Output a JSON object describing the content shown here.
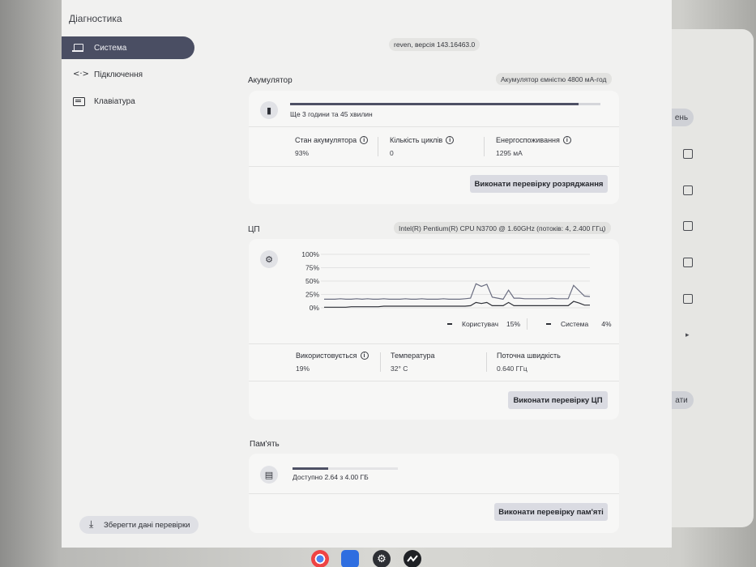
{
  "app": {
    "title": "Діагностика",
    "nav": [
      {
        "label": "Система",
        "icon": "laptop-icon",
        "active": true
      },
      {
        "label": "Підключення",
        "icon": "link-icon",
        "active": false
      },
      {
        "label": "Клавіатура",
        "icon": "keyboard-icon",
        "active": false
      }
    ],
    "save_button": "Зберегти дані перевірки",
    "version": "reven, версія 143.16463.0"
  },
  "battery": {
    "title": "Акумулятор",
    "capacity": "Акумулятор ємністю 4800 мА-год",
    "time_left": "Ще 3 години та 45 хвилин",
    "charge_fraction": 0.93,
    "metrics": [
      {
        "label": "Стан акумулятора",
        "value": "93%"
      },
      {
        "label": "Кількість циклів",
        "value": "0"
      },
      {
        "label": "Енергоспоживання",
        "value": "1295 мА"
      }
    ],
    "button": "Виконати перевірку розряджання"
  },
  "cpu": {
    "title": "ЦП",
    "model": "Intel(R) Pentium(R) CPU N3700 @ 1.60GHz (потоків: 4, 2.400 ГГц)",
    "legend": [
      {
        "label": "Користувач",
        "value": "15%"
      },
      {
        "label": "Система",
        "value": "4%"
      }
    ],
    "metrics": [
      {
        "label": "Використовується",
        "value": "19%"
      },
      {
        "label": "Температура",
        "value": "32° C"
      },
      {
        "label": "Поточна швидкість",
        "value": "0.640 ГГц"
      }
    ],
    "button": "Виконати перевірку ЦП"
  },
  "memory": {
    "title": "Пам'ять",
    "available": "Доступно 2.64 з 4.00 ГБ",
    "used_fraction": 0.34,
    "button": "Виконати перевірку пам'яті"
  },
  "chart_data": {
    "type": "line",
    "y_ticks": [
      "100%",
      "75%",
      "50%",
      "25%",
      "0%"
    ],
    "ylim": [
      0,
      100
    ],
    "series": [
      {
        "name": "Користувач",
        "values": [
          16,
          16,
          16,
          17,
          16,
          16,
          17,
          16,
          17,
          16,
          16,
          17,
          16,
          16,
          16,
          17,
          16,
          16,
          17,
          16,
          16,
          16,
          17,
          16,
          16,
          16,
          17,
          18,
          45,
          40,
          44,
          20,
          18,
          16,
          33,
          18,
          18,
          17,
          17,
          17,
          17,
          17,
          18,
          17,
          17,
          17,
          42,
          32,
          22,
          21
        ]
      },
      {
        "name": "Система",
        "values": [
          1,
          1,
          1,
          1,
          1,
          2,
          2,
          2,
          2,
          2,
          2,
          3,
          3,
          3,
          3,
          3,
          3,
          3,
          3,
          3,
          3,
          3,
          3,
          3,
          3,
          3,
          3,
          4,
          10,
          8,
          10,
          4,
          4,
          4,
          10,
          4,
          4,
          4,
          4,
          4,
          4,
          4,
          4,
          4,
          4,
          4,
          12,
          9,
          5,
          5
        ]
      }
    ]
  },
  "background_window": {
    "pill_text": "ень",
    "pill2_text": "ати"
  }
}
